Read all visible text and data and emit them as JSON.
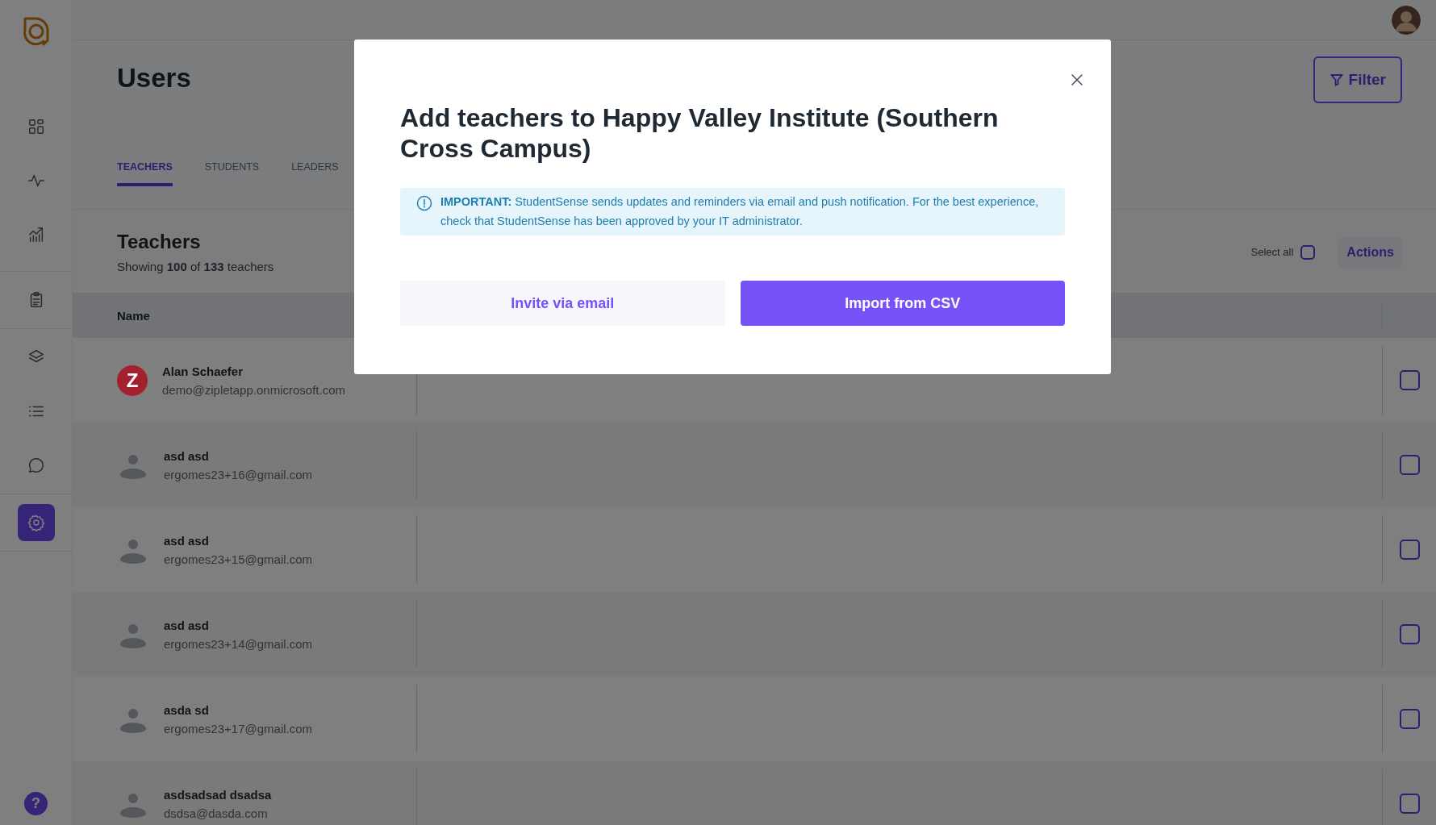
{
  "sidebar": {
    "groups": [
      {
        "items": [
          {
            "selected": false
          },
          {
            "selected": false
          },
          {
            "selected": false
          }
        ]
      },
      {
        "items": [
          {
            "selected": false
          }
        ]
      },
      {
        "items": [
          {
            "selected": false
          },
          {
            "selected": false
          },
          {
            "selected": false
          }
        ]
      },
      {
        "items": [
          {
            "selected": true
          }
        ]
      }
    ],
    "help": "?"
  },
  "page": {
    "title": "Users",
    "filter_button": "Filter"
  },
  "tabs": [
    {
      "label": "TEACHERS",
      "selected": true
    },
    {
      "label": "STUDENTS",
      "selected": false
    },
    {
      "label": "LEADERS",
      "selected": false
    }
  ],
  "section": {
    "title": "Teachers",
    "summary": "Showing **100** of **133** teachers",
    "select_all": {
      "label": "Select all",
      "checked": false
    },
    "actions_button": "Actions"
  },
  "table": {
    "columns": [
      "Name"
    ],
    "rows": [
      {
        "name": "Alan Schaefer",
        "email": "demo@zipletapp.onmicrosoft.com",
        "avatar": {
          "kind": "letter",
          "initial": "Z",
          "color": "#a3212f"
        },
        "checked": false
      },
      {
        "name": "asd asd",
        "email": "ergomes23+16@gmail.com",
        "avatar": {
          "kind": "silhouette"
        },
        "checked": false
      },
      {
        "name": "asd asd",
        "email": "ergomes23+15@gmail.com",
        "avatar": {
          "kind": "silhouette"
        },
        "checked": false
      },
      {
        "name": "asd asd",
        "email": "ergomes23+14@gmail.com",
        "avatar": {
          "kind": "silhouette"
        },
        "checked": false
      },
      {
        "name": "asda sd",
        "email": "ergomes23+17@gmail.com",
        "avatar": {
          "kind": "silhouette"
        },
        "checked": false
      },
      {
        "name": "asdsadsad dsadsa",
        "email": "dsdsa@dasda.com",
        "avatar": {
          "kind": "silhouette"
        },
        "checked": false
      }
    ]
  },
  "modal": {
    "title": "Add teachers to Happy Valley Institute (Southern Cross Campus)",
    "notice": "**IMPORTANT:** StudentSense sends updates and reminders via email and push notification. For the best experience, check that StudentSense has been approved by your IT administrator.",
    "buttons": [
      {
        "label": "Invite via email",
        "kind": "secondary"
      },
      {
        "label": "Import from CSV",
        "kind": "primary"
      }
    ]
  }
}
